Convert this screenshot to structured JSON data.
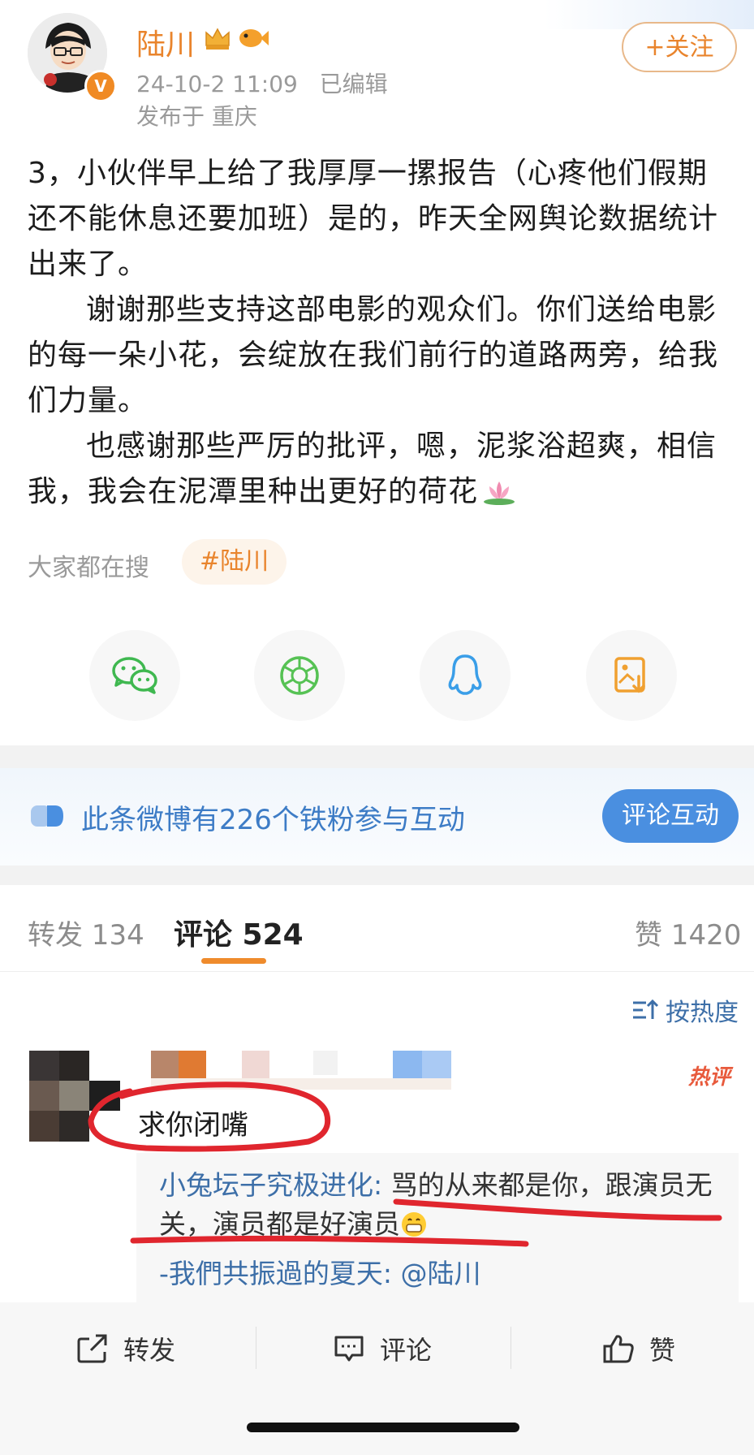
{
  "header": {
    "username": "陆川",
    "post_time": "24-10-2 11:09",
    "edited": "已编辑",
    "location": "发布于 重庆",
    "follow_label": "+关注"
  },
  "post": {
    "para1": "3，小伙伴早上给了我厚厚一摞报告（心疼他们假期还不能休息还要加班）是的，昨天全网舆论数据统计出来了。",
    "para2": "谢谢那些支持这部电影的观众们。你们送给电影的每一朵小花，会绽放在我们前行的道路两旁，给我们力量。",
    "para3": "也感谢那些严厉的批评，嗯，泥浆浴超爽，相信我，我会在泥潭里种出更好的荷花"
  },
  "searching": {
    "label": "大家都在搜",
    "hashtag": "#陆川"
  },
  "share": {
    "icons": [
      "wechat-icon",
      "moments-icon",
      "qq-icon",
      "save-image-icon"
    ],
    "colors": {
      "wechat": "#3fb850",
      "moments": "#56c254",
      "qq": "#3a9ee8",
      "save": "#f0a030"
    }
  },
  "fans_banner": {
    "text": "此条微博有226个铁粉参与互动",
    "button": "评论互动"
  },
  "tabs": {
    "reposts": "转发 134",
    "comments": "评论 524",
    "likes": "赞 1420",
    "sort": "按热度"
  },
  "comment": {
    "hot_badge": "热评",
    "text": "求你闭嘴",
    "reply_user": "小兔坛子究极进化",
    "reply_colon": ": ",
    "reply_text": "骂的从来都是你，跟演员无关，演员都是好演员",
    "reply_from": "-我們共振過的夏天: @陆川"
  },
  "bottom_bar": {
    "repost": "转发",
    "comment": "评论",
    "like": "赞"
  },
  "colors": {
    "accent_orange": "#e9842c",
    "link_blue": "#3d6fa8",
    "annotation_red": "#e0262e"
  }
}
